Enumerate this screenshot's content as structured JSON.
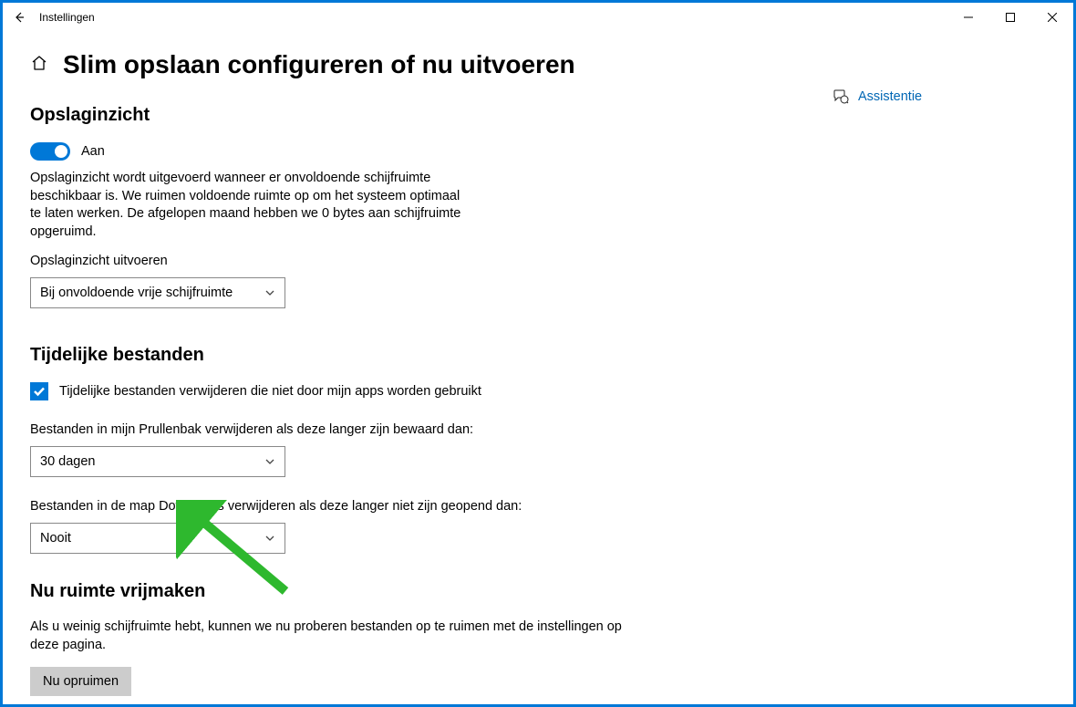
{
  "window": {
    "title": "Instellingen"
  },
  "page": {
    "title": "Slim opslaan configureren of nu uitvoeren"
  },
  "storageSense": {
    "sectionTitle": "Opslaginzicht",
    "toggleLabel": "Aan",
    "description": "Opslaginzicht wordt uitgevoerd wanneer er onvoldoende schijfruimte beschikbaar is. We ruimen voldoende ruimte op om het systeem optimaal te laten werken. De afgelopen maand hebben we 0 bytes aan schijfruimte opgeruimd.",
    "runLabel": "Opslaginzicht uitvoeren",
    "runValue": "Bij onvoldoende vrije schijfruimte"
  },
  "tempFiles": {
    "sectionTitle": "Tijdelijke bestanden",
    "checkboxLabel": "Tijdelijke bestanden verwijderen die niet door mijn apps worden gebruikt",
    "recycleLabel": "Bestanden in mijn Prullenbak verwijderen als deze langer zijn bewaard dan:",
    "recycleValue": "30 dagen",
    "downloadsLabel": "Bestanden in de map Downloads verwijderen als deze langer niet zijn geopend dan:",
    "downloadsValue": "Nooit"
  },
  "freeNow": {
    "sectionTitle": "Nu ruimte vrijmaken",
    "description": "Als u weinig schijfruimte hebt, kunnen we nu proberen bestanden op te ruimen met de instellingen op deze pagina.",
    "buttonLabel": "Nu opruimen"
  },
  "help": {
    "label": "Assistentie"
  }
}
